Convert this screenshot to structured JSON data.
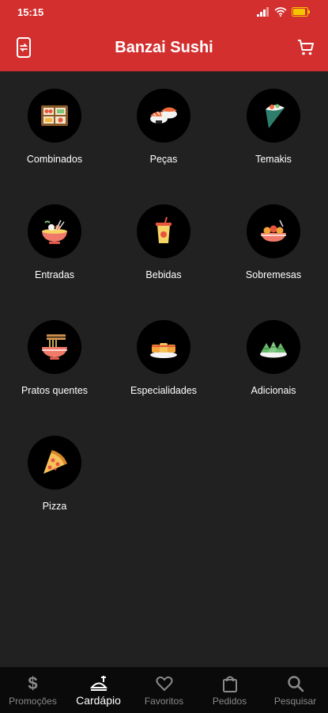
{
  "status_bar": {
    "time": "15:15",
    "battery_color": "#f5c400"
  },
  "app_bar": {
    "title": "Banzai Sushi",
    "background": "#d32f2f"
  },
  "categories": [
    {
      "label": "Combinados",
      "icon": "bento-box-icon"
    },
    {
      "label": "Peças",
      "icon": "nigiri-icon"
    },
    {
      "label": "Temakis",
      "icon": "temaki-icon"
    },
    {
      "label": "Entradas",
      "icon": "soup-bowl-icon"
    },
    {
      "label": "Bebidas",
      "icon": "drink-cup-icon"
    },
    {
      "label": "Sobremesas",
      "icon": "dessert-bowl-icon"
    },
    {
      "label": "Pratos quentes",
      "icon": "noodle-bowl-icon"
    },
    {
      "label": "Especialidades",
      "icon": "rolls-plate-icon"
    },
    {
      "label": "Adicionais",
      "icon": "dumplings-icon"
    },
    {
      "label": "Pizza",
      "icon": "pizza-icon"
    }
  ],
  "bottom_nav": {
    "items": [
      {
        "label": "Promoções",
        "icon": "dollar-icon"
      },
      {
        "label": "Cardápio",
        "icon": "menu-food-icon",
        "active": true
      },
      {
        "label": "Favoritos",
        "icon": "heart-icon"
      },
      {
        "label": "Pedidos",
        "icon": "shopping-bag-icon"
      },
      {
        "label": "Pesquisar",
        "icon": "search-icon"
      }
    ]
  }
}
